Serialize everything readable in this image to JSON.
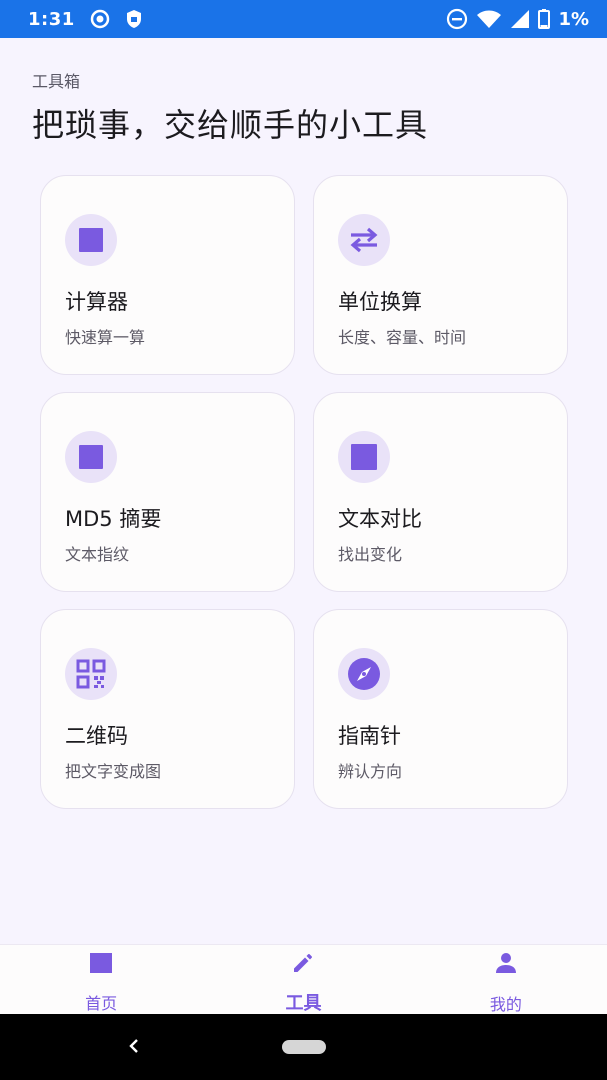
{
  "status_bar": {
    "time": "1:31",
    "battery_text": "1%",
    "icons": [
      "record-icon",
      "shield-icon",
      "dnd-icon",
      "wifi-icon",
      "signal-icon",
      "battery-icon"
    ],
    "color": "#1a73e8"
  },
  "header": {
    "eyebrow": "工具箱",
    "title": "把琐事，交给顺手的小工具"
  },
  "tools": [
    {
      "title": "计算器",
      "subtitle": "快速算一算",
      "icon": "calculator-icon"
    },
    {
      "title": "单位换算",
      "subtitle": "长度、容量、时间",
      "icon": "swap-arrows-icon"
    },
    {
      "title": "MD5 摘要",
      "subtitle": "文本指纹",
      "icon": "hash-icon"
    },
    {
      "title": "文本对比",
      "subtitle": "找出变化",
      "icon": "compare-icon"
    },
    {
      "title": "二维码",
      "subtitle": "把文字变成图",
      "icon": "qr-code-icon"
    },
    {
      "title": "指南针",
      "subtitle": "辨认方向",
      "icon": "compass-icon"
    }
  ],
  "bottom_nav": {
    "items": [
      {
        "label": "首页",
        "icon": "home-icon"
      },
      {
        "label": "工具",
        "icon": "pencil-icon",
        "active": true
      },
      {
        "label": "我的",
        "icon": "person-icon"
      }
    ]
  },
  "colors": {
    "accent": "#7a5ae0",
    "background": "#f7f4fe",
    "card": "#fdfcfc",
    "icon_bg": "#e9e2f8"
  }
}
